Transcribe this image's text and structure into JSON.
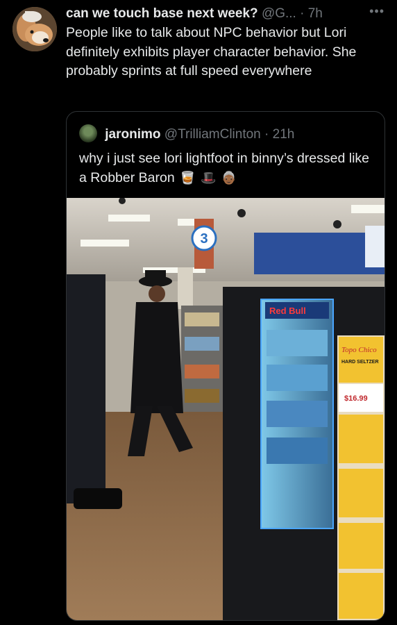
{
  "tweet": {
    "display_name": "can we touch base next week?",
    "handle": "@G...",
    "separator": "·",
    "time": "7h",
    "more_icon": "more-dots-icon",
    "text": "People like to talk about NPC behavior but Lori definitely exhibits player character behavior. She probably sprints at full speed everywhere"
  },
  "quoted_tweet": {
    "display_name": "jaronimo",
    "handle": "@TrilliamClinton",
    "separator": "·",
    "time": "21h",
    "text": "why i just see lori lightfoot in binny’s dressed like a Robber Baron",
    "emojis": [
      "🥃",
      "🎩",
      "👵🏾"
    ],
    "photo": {
      "aisle_number": "3",
      "cooler_brand": "Red Bull",
      "product_brand": "Topo Chico",
      "product_type": "HARD SELTZER",
      "price": "$16.99"
    }
  },
  "colors": {
    "background": "#000000",
    "text": "#e7e9ea",
    "secondary": "#71767b",
    "border": "#2f3336"
  }
}
